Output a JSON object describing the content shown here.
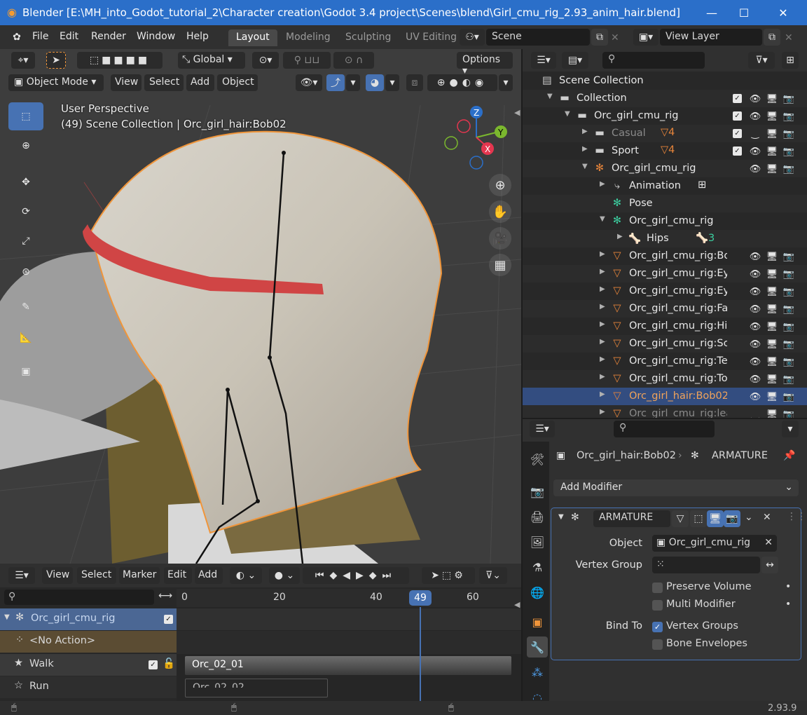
{
  "window": {
    "title": "Blender [E:\\MH_into_Godot_tutorial_2\\Character creation\\Godot 3.4 project\\Scenes\\blend\\Girl_cmu_rig_2.93_anim_hair.blend]",
    "minimize": "—",
    "maximize": "☐",
    "close": "✕"
  },
  "menu": [
    "File",
    "Edit",
    "Render",
    "Window",
    "Help"
  ],
  "workspaces": [
    "Layout",
    "Modeling",
    "Sculpting",
    "UV Editing"
  ],
  "scene": "Scene",
  "view_layer": "View Layer",
  "viewport": {
    "transform_orientation": "Global",
    "options_label": "Options",
    "mode": "Object Mode",
    "header_menus": [
      "View",
      "Select",
      "Add",
      "Object"
    ],
    "info_line1": "User Perspective",
    "info_line2": "(49) Scene Collection | Orc_girl_hair:Bob02",
    "gizmo": {
      "z": "Z",
      "y": "Y",
      "x": "X"
    }
  },
  "outliner": {
    "rows": [
      {
        "label": "Scene Collection",
        "indent": 0,
        "icon": "scene-collection-icon"
      },
      {
        "label": "Collection",
        "indent": 1,
        "icon": "collection-icon",
        "check": true
      },
      {
        "label": "Orc_girl_cmu_rig",
        "indent": 2,
        "icon": "collection-icon",
        "check": true
      },
      {
        "label": "Casual",
        "indent": 3,
        "icon": "collection-icon",
        "check": true,
        "dim": true,
        "badge": "4"
      },
      {
        "label": "Sport",
        "indent": 3,
        "icon": "collection-icon",
        "check": true,
        "badge": "4"
      },
      {
        "label": "Orc_girl_cmu_rig",
        "indent": 3,
        "icon": "armature-icon"
      },
      {
        "label": "Animation",
        "indent": 4,
        "icon": "animation-icon"
      },
      {
        "label": "Pose",
        "indent": 4,
        "icon": "pose-icon"
      },
      {
        "label": "Orc_girl_cmu_rig",
        "indent": 4,
        "icon": "armature-data-icon"
      },
      {
        "label": "Hips",
        "indent": 5,
        "icon": "bone-icon",
        "badge": "3"
      },
      {
        "label": "Orc_girl_cmu_rig:Bod",
        "indent": 4,
        "icon": "mesh-icon"
      },
      {
        "label": "Orc_girl_cmu_rig:Eye",
        "indent": 4,
        "icon": "mesh-icon"
      },
      {
        "label": "Orc_girl_cmu_rig:Eye",
        "indent": 4,
        "icon": "mesh-icon"
      },
      {
        "label": "Orc_girl_cmu_rig:Fan",
        "indent": 4,
        "icon": "mesh-icon"
      },
      {
        "label": "Orc_girl_cmu_rig:Higl",
        "indent": 4,
        "icon": "mesh-icon"
      },
      {
        "label": "Orc_girl_cmu_rig:Sca",
        "indent": 4,
        "icon": "mesh-icon"
      },
      {
        "label": "Orc_girl_cmu_rig:Teet",
        "indent": 4,
        "icon": "mesh-icon"
      },
      {
        "label": "Orc_girl_cmu_rig:Ton",
        "indent": 4,
        "icon": "mesh-icon"
      },
      {
        "label": "Orc_girl_hair:Bob02",
        "indent": 4,
        "icon": "mesh-icon",
        "selected": true
      },
      {
        "label": "Orc_girl_cmu_rig:lear",
        "indent": 4,
        "icon": "mesh-icon",
        "dim": true
      }
    ]
  },
  "properties": {
    "object_name": "Orc_girl_hair:Bob02",
    "modifier_breadcrumb": "ARMATURE",
    "add_modifier": "Add Modifier",
    "modifier_name": "ARMATURE",
    "object_label": "Object",
    "object_value": "Orc_girl_cmu_rig",
    "vertex_group_label": "Vertex Group",
    "vertex_group_value": "",
    "preserve_volume": "Preserve Volume",
    "multi_modifier": "Multi Modifier",
    "bind_to_label": "Bind To",
    "vertex_groups": "Vertex Groups",
    "bone_envelopes": "Bone Envelopes"
  },
  "timeline": {
    "menus": [
      "View",
      "Select",
      "Marker",
      "Edit",
      "Add"
    ],
    "frame_ticks": [
      "0",
      "20",
      "40",
      "60"
    ],
    "current_frame": "49",
    "tracks": [
      {
        "label": "Orc_girl_cmu_rig"
      },
      {
        "label": "<No Action>"
      },
      {
        "label": "Walk"
      },
      {
        "label": "Run"
      }
    ],
    "strip1": "Orc_02_01",
    "strip2": "Orc_02_02"
  },
  "status": {
    "version": "2.93.9"
  }
}
